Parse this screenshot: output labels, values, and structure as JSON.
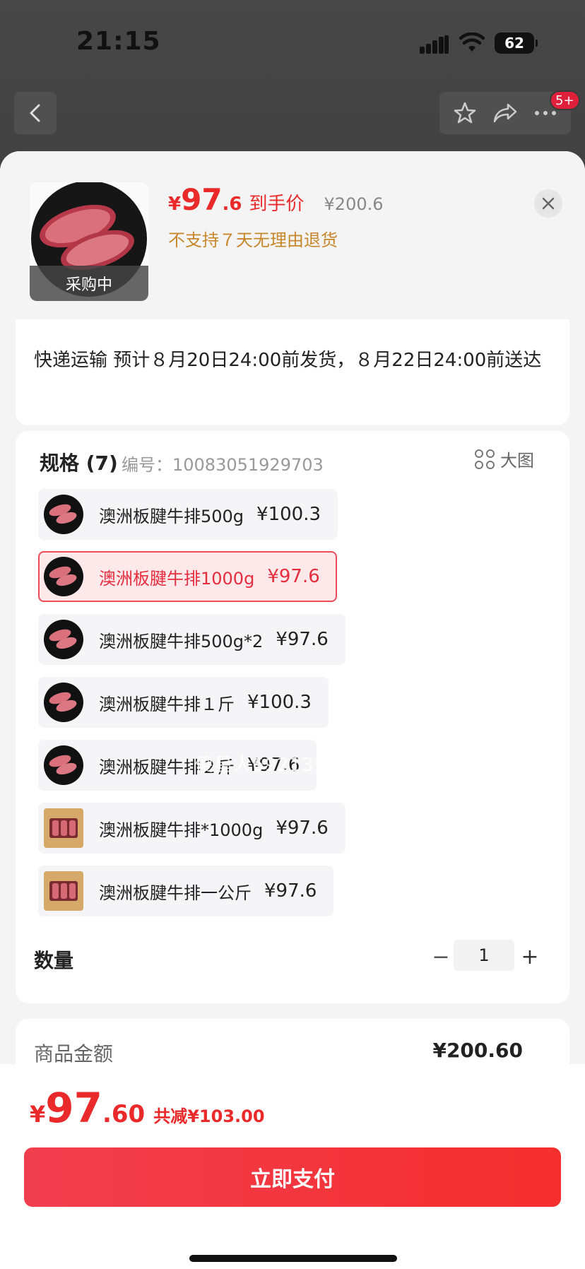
{
  "status_bar": {
    "time": "21:15",
    "battery": "62"
  },
  "nav": {
    "badge": "5+"
  },
  "product": {
    "price_currency": "¥",
    "price_int": "97",
    "price_dec": ".6",
    "price_tag": "到手价",
    "original_price": "¥200.6",
    "notice": "不支持７天无理由退货",
    "thumb_tag": "采购中"
  },
  "shipping": {
    "text": "快递运输 预计８月20日24:00前发货，８月22日24:00前送达"
  },
  "spec": {
    "title": "规格 (7)",
    "code_label": "编号：10083051929703",
    "big_view": "大图",
    "options": [
      {
        "label": "澳洲板腱牛排500g",
        "price": "¥100.3",
        "selected": false,
        "img": "round"
      },
      {
        "label": "澳洲板腱牛排1000g",
        "price": "¥97.6",
        "selected": true,
        "img": "round"
      },
      {
        "label": "澳洲板腱牛排500g*2",
        "price": "¥97.6",
        "selected": false,
        "img": "round"
      },
      {
        "label": "澳洲板腱牛排１斤",
        "price": "¥100.3",
        "selected": false,
        "img": "round"
      },
      {
        "label": "澳洲板腱牛排２斤",
        "price": "¥97.6",
        "selected": false,
        "img": "round"
      },
      {
        "label": "澳洲板腱牛排*1000g",
        "price": "¥97.6",
        "selected": false,
        "img": "box"
      },
      {
        "label": "澳洲板腱牛排一公斤",
        "price": "¥97.6",
        "selected": false,
        "img": "box"
      }
    ]
  },
  "quantity": {
    "label": "数量",
    "minus": "−",
    "value": "1",
    "plus": "+"
  },
  "amount": {
    "label": "商品金额",
    "value": "¥200.60"
  },
  "footer": {
    "total_currency": "¥",
    "total_int": "97",
    "total_dec": ".60",
    "savings": "共减¥103.00",
    "pay_label": "立即支付"
  },
  "watermark": "傻星人6921334EW",
  "colors": {
    "accent": "#ea2a2a",
    "notice": "#c8862a",
    "selected_bg": "#fde8ea"
  }
}
